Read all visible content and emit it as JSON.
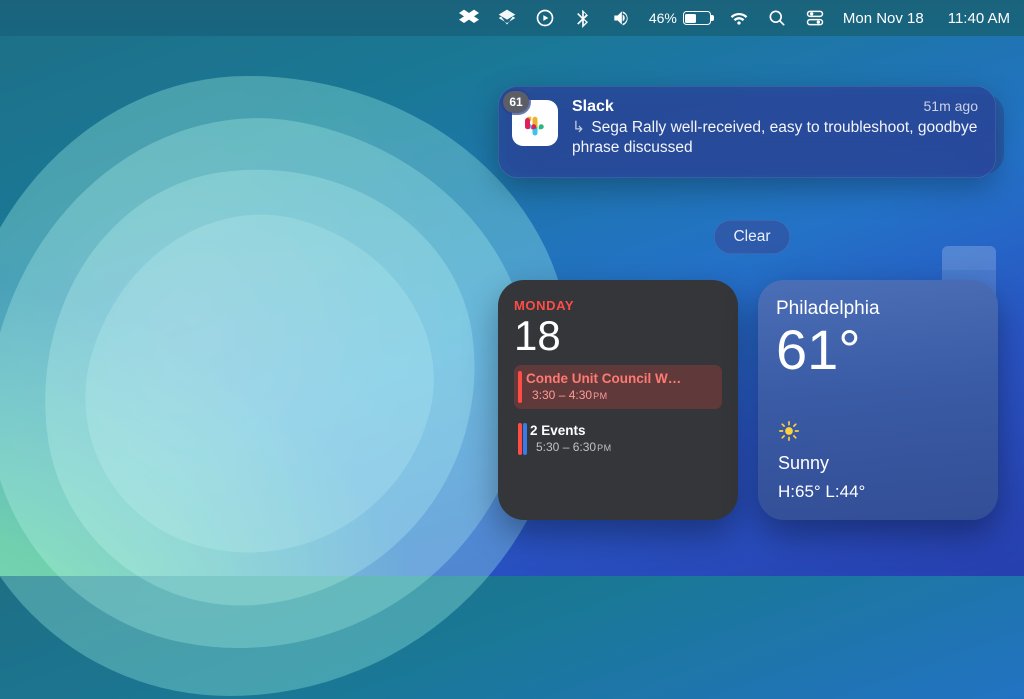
{
  "menubar": {
    "icons": [
      "dropbox",
      "stack",
      "play-circle",
      "bluetooth",
      "volume"
    ],
    "battery_pct": "46%",
    "date": "Mon Nov 18",
    "time": "11:40 AM"
  },
  "notification": {
    "app": "Slack",
    "badge": "61",
    "time_ago": "51m ago",
    "message": "Sega Rally well-received, easy to troubleshoot, goodbye phrase discussed"
  },
  "clear_label": "Clear",
  "calendar": {
    "dow": "MONDAY",
    "day": "18",
    "events": [
      {
        "title": "Conde Unit Council W…",
        "time": "3:30 – 4:30",
        "pm": "PM"
      },
      {
        "title": "2 Events",
        "time": "5:30 – 6:30",
        "pm": "PM"
      }
    ]
  },
  "weather": {
    "city": "Philadelphia",
    "temp": "61°",
    "condition": "Sunny",
    "hilo": "H:65° L:44°"
  }
}
